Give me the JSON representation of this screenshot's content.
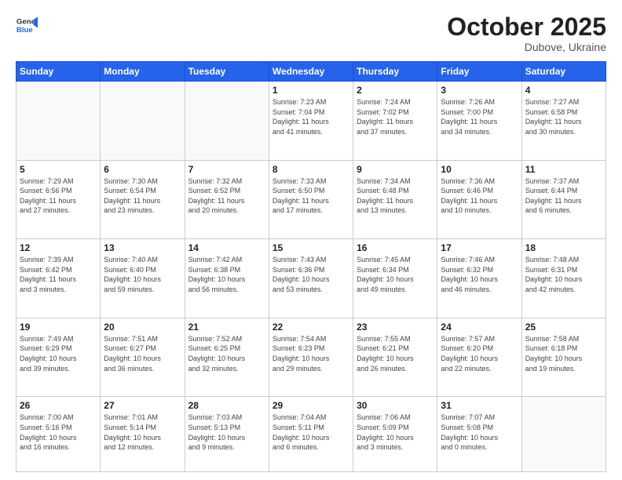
{
  "header": {
    "logo_general": "General",
    "logo_blue": "Blue",
    "month_title": "October 2025",
    "location": "Dubove, Ukraine"
  },
  "days_of_week": [
    "Sunday",
    "Monday",
    "Tuesday",
    "Wednesday",
    "Thursday",
    "Friday",
    "Saturday"
  ],
  "weeks": [
    [
      {
        "day": "",
        "info": ""
      },
      {
        "day": "",
        "info": ""
      },
      {
        "day": "",
        "info": ""
      },
      {
        "day": "1",
        "info": "Sunrise: 7:23 AM\nSunset: 7:04 PM\nDaylight: 11 hours\nand 41 minutes."
      },
      {
        "day": "2",
        "info": "Sunrise: 7:24 AM\nSunset: 7:02 PM\nDaylight: 11 hours\nand 37 minutes."
      },
      {
        "day": "3",
        "info": "Sunrise: 7:26 AM\nSunset: 7:00 PM\nDaylight: 11 hours\nand 34 minutes."
      },
      {
        "day": "4",
        "info": "Sunrise: 7:27 AM\nSunset: 6:58 PM\nDaylight: 11 hours\nand 30 minutes."
      }
    ],
    [
      {
        "day": "5",
        "info": "Sunrise: 7:29 AM\nSunset: 6:56 PM\nDaylight: 11 hours\nand 27 minutes."
      },
      {
        "day": "6",
        "info": "Sunrise: 7:30 AM\nSunset: 6:54 PM\nDaylight: 11 hours\nand 23 minutes."
      },
      {
        "day": "7",
        "info": "Sunrise: 7:32 AM\nSunset: 6:52 PM\nDaylight: 11 hours\nand 20 minutes."
      },
      {
        "day": "8",
        "info": "Sunrise: 7:33 AM\nSunset: 6:50 PM\nDaylight: 11 hours\nand 17 minutes."
      },
      {
        "day": "9",
        "info": "Sunrise: 7:34 AM\nSunset: 6:48 PM\nDaylight: 11 hours\nand 13 minutes."
      },
      {
        "day": "10",
        "info": "Sunrise: 7:36 AM\nSunset: 6:46 PM\nDaylight: 11 hours\nand 10 minutes."
      },
      {
        "day": "11",
        "info": "Sunrise: 7:37 AM\nSunset: 6:44 PM\nDaylight: 11 hours\nand 6 minutes."
      }
    ],
    [
      {
        "day": "12",
        "info": "Sunrise: 7:39 AM\nSunset: 6:42 PM\nDaylight: 11 hours\nand 3 minutes."
      },
      {
        "day": "13",
        "info": "Sunrise: 7:40 AM\nSunset: 6:40 PM\nDaylight: 10 hours\nand 59 minutes."
      },
      {
        "day": "14",
        "info": "Sunrise: 7:42 AM\nSunset: 6:38 PM\nDaylight: 10 hours\nand 56 minutes."
      },
      {
        "day": "15",
        "info": "Sunrise: 7:43 AM\nSunset: 6:36 PM\nDaylight: 10 hours\nand 53 minutes."
      },
      {
        "day": "16",
        "info": "Sunrise: 7:45 AM\nSunset: 6:34 PM\nDaylight: 10 hours\nand 49 minutes."
      },
      {
        "day": "17",
        "info": "Sunrise: 7:46 AM\nSunset: 6:32 PM\nDaylight: 10 hours\nand 46 minutes."
      },
      {
        "day": "18",
        "info": "Sunrise: 7:48 AM\nSunset: 6:31 PM\nDaylight: 10 hours\nand 42 minutes."
      }
    ],
    [
      {
        "day": "19",
        "info": "Sunrise: 7:49 AM\nSunset: 6:29 PM\nDaylight: 10 hours\nand 39 minutes."
      },
      {
        "day": "20",
        "info": "Sunrise: 7:51 AM\nSunset: 6:27 PM\nDaylight: 10 hours\nand 36 minutes."
      },
      {
        "day": "21",
        "info": "Sunrise: 7:52 AM\nSunset: 6:25 PM\nDaylight: 10 hours\nand 32 minutes."
      },
      {
        "day": "22",
        "info": "Sunrise: 7:54 AM\nSunset: 6:23 PM\nDaylight: 10 hours\nand 29 minutes."
      },
      {
        "day": "23",
        "info": "Sunrise: 7:55 AM\nSunset: 6:21 PM\nDaylight: 10 hours\nand 26 minutes."
      },
      {
        "day": "24",
        "info": "Sunrise: 7:57 AM\nSunset: 6:20 PM\nDaylight: 10 hours\nand 22 minutes."
      },
      {
        "day": "25",
        "info": "Sunrise: 7:58 AM\nSunset: 6:18 PM\nDaylight: 10 hours\nand 19 minutes."
      }
    ],
    [
      {
        "day": "26",
        "info": "Sunrise: 7:00 AM\nSunset: 5:16 PM\nDaylight: 10 hours\nand 16 minutes."
      },
      {
        "day": "27",
        "info": "Sunrise: 7:01 AM\nSunset: 5:14 PM\nDaylight: 10 hours\nand 12 minutes."
      },
      {
        "day": "28",
        "info": "Sunrise: 7:03 AM\nSunset: 5:13 PM\nDaylight: 10 hours\nand 9 minutes."
      },
      {
        "day": "29",
        "info": "Sunrise: 7:04 AM\nSunset: 5:11 PM\nDaylight: 10 hours\nand 6 minutes."
      },
      {
        "day": "30",
        "info": "Sunrise: 7:06 AM\nSunset: 5:09 PM\nDaylight: 10 hours\nand 3 minutes."
      },
      {
        "day": "31",
        "info": "Sunrise: 7:07 AM\nSunset: 5:08 PM\nDaylight: 10 hours\nand 0 minutes."
      },
      {
        "day": "",
        "info": ""
      }
    ]
  ]
}
